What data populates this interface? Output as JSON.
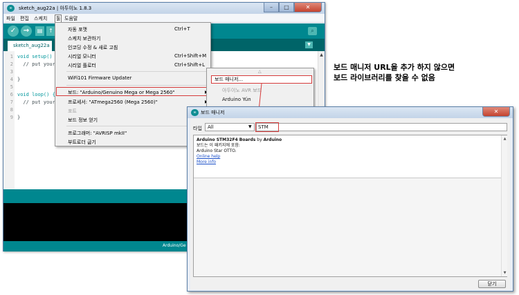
{
  "ide": {
    "title": "sketch_aug22a | 아두이노 1.8.3",
    "app_icon": "∞",
    "menu": [
      "파일",
      "편집",
      "스케치",
      "툴",
      "도움말"
    ],
    "tab": "sketch_aug22a",
    "code_lines": [
      {
        "n": "1",
        "text": "void setup() {"
      },
      {
        "n": "2",
        "text": "  // put your"
      },
      {
        "n": "3",
        "text": ""
      },
      {
        "n": "4",
        "text": "}"
      },
      {
        "n": "5",
        "text": ""
      },
      {
        "n": "6",
        "text": "void loop() {"
      },
      {
        "n": "7",
        "text": "  // put your"
      },
      {
        "n": "8",
        "text": ""
      },
      {
        "n": "9",
        "text": "}"
      }
    ],
    "status": "Arduino/Ge"
  },
  "tools_menu": {
    "items": [
      {
        "label": "자동 포맷",
        "shortcut": "Ctrl+T"
      },
      {
        "label": "스케치 보관하기",
        "shortcut": ""
      },
      {
        "label": "인코딩 수정 & 새로 고침",
        "shortcut": ""
      },
      {
        "label": "시리얼 모니터",
        "shortcut": "Ctrl+Shift+M"
      },
      {
        "label": "시리얼 플로터",
        "shortcut": "Ctrl+Shift+L"
      },
      {
        "label": "WiFi101 Firmware Updater",
        "shortcut": ""
      },
      {
        "label": "보드: \"Arduino/Genuino Mega or Mega 2560\"",
        "shortcut": ""
      },
      {
        "label": "프로세서: \"ATmega2560 (Mega 2560)\"",
        "shortcut": ""
      },
      {
        "label": "포트",
        "shortcut": ""
      },
      {
        "label": "보드 정보 얻기",
        "shortcut": ""
      },
      {
        "label": "프로그래머: \"AVRISP mkII\"",
        "shortcut": ""
      },
      {
        "label": "부트로더 굽기",
        "shortcut": ""
      }
    ]
  },
  "board_submenu": {
    "items": [
      "보드 매니저...",
      "아두이노 AVR 보드",
      "Arduino Yún"
    ]
  },
  "annotation": {
    "line1": "보드 매니저 URL을 추가 하지 않으면",
    "line2": "보드 라이브러리를 찾을 수 없음"
  },
  "boards_manager": {
    "title": "보드 매니저",
    "type_label": "타입",
    "type_value": "All",
    "search_value": "STM",
    "entry": {
      "name": "Arduino STM32F4 Boards",
      "by": " by ",
      "author": "Arduino",
      "desc1": "보드는 이 패키지에 포함:",
      "desc2": "Arduino Star OTTO.",
      "link1": "Online help",
      "link2": "More info"
    },
    "close_label": "닫기"
  },
  "colors": {
    "arduino_teal": "#00878f",
    "highlight_red": "#d63a3a"
  }
}
